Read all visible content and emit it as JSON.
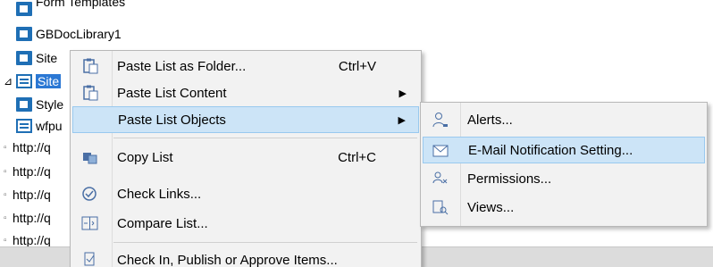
{
  "tree": {
    "items": [
      {
        "label": "Form Templates",
        "icon": "document-library-icon"
      },
      {
        "label": "GBDocLibrary1",
        "icon": "document-library-icon"
      },
      {
        "label": "Site",
        "icon": "document-library-icon"
      },
      {
        "label": "Site",
        "icon": "list-icon"
      },
      {
        "label": "Style",
        "icon": "document-library-icon"
      },
      {
        "label": "wfpu",
        "icon": "list-icon"
      },
      {
        "label": "http://q",
        "icon": "site-icon"
      },
      {
        "label": "http://q",
        "icon": "site-icon"
      },
      {
        "label": "http://q",
        "icon": "site-icon"
      },
      {
        "label": "http://q",
        "icon": "site-icon"
      },
      {
        "label": "http://q",
        "icon": "site-icon"
      }
    ]
  },
  "context_menu": {
    "items": [
      {
        "label": "Paste List as Folder...",
        "shortcut": "Ctrl+V",
        "icon": "paste-folder-icon"
      },
      {
        "label": "Paste List Content",
        "shortcut": "",
        "submenu": true,
        "icon": "paste-icon"
      },
      {
        "label": "Paste List Objects",
        "shortcut": "",
        "submenu": true,
        "icon": "",
        "highlighted": true
      },
      {
        "label": "Copy List",
        "shortcut": "Ctrl+C",
        "icon": "copy-list-icon"
      },
      {
        "label": "Check Links...",
        "shortcut": "",
        "icon": "check-links-icon"
      },
      {
        "label": "Compare List...",
        "shortcut": "",
        "icon": "compare-icon"
      },
      {
        "label": "Check In, Publish or Approve Items...",
        "shortcut": "",
        "icon": "check-in-icon"
      }
    ],
    "arrow_glyph": "▶"
  },
  "submenu": {
    "items": [
      {
        "label": "Alerts...",
        "icon": "alerts-icon"
      },
      {
        "label": "E-Mail Notification Setting...",
        "icon": "email-notification-icon",
        "highlighted": true
      },
      {
        "label": "Permissions...",
        "icon": "permissions-icon"
      },
      {
        "label": "Views...",
        "icon": "views-icon"
      }
    ]
  },
  "colors": {
    "selection": "#2b78d4",
    "menu_highlight": "#cce4f7",
    "icon_blue": "#1f6fb5"
  }
}
